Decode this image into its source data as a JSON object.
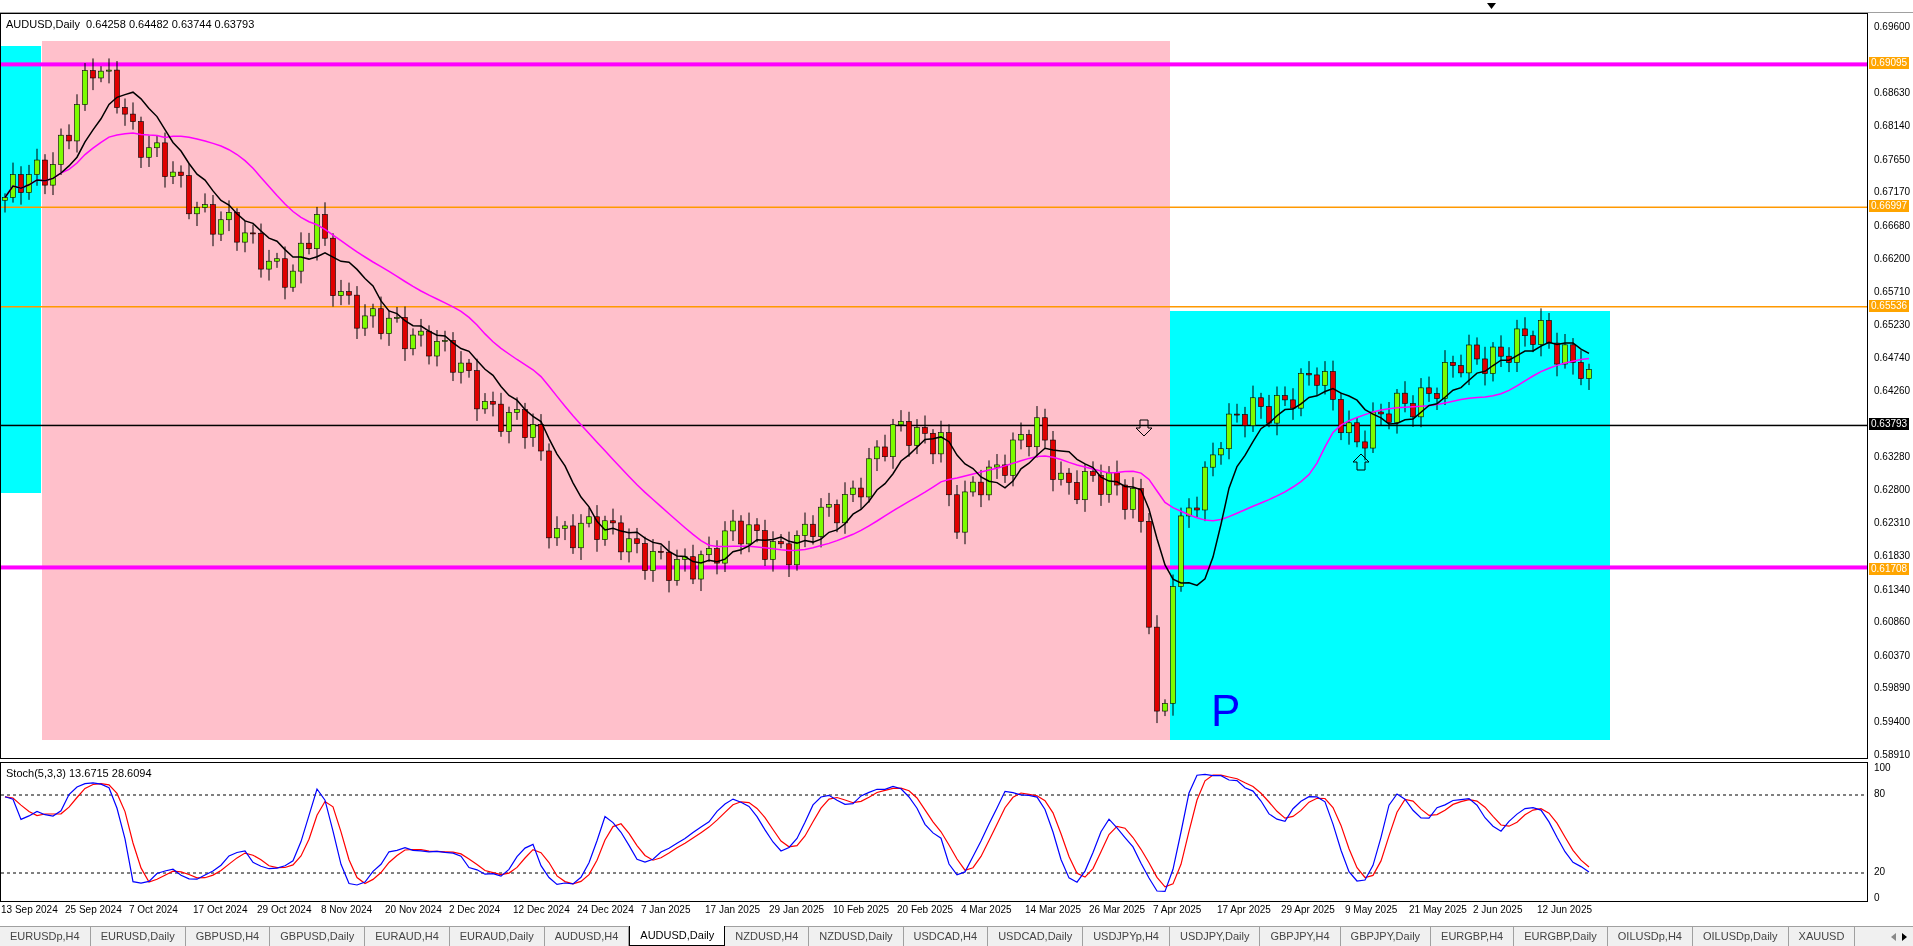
{
  "chart_header": {
    "symbol": "AUDUSD,Daily",
    "ohlc": "0.64258 0.64482 0.63744 0.63793"
  },
  "price_axis": [
    "0.69600",
    "0.68630",
    "0.68140",
    "0.67650",
    "0.67170",
    "0.66680",
    "0.66200",
    "0.65710",
    "0.65230",
    "0.64740",
    "0.64260",
    "0.63280",
    "0.62800",
    "0.62310",
    "0.61830",
    "0.61340",
    "0.60860",
    "0.60370",
    "0.59890",
    "0.59400",
    "0.58910"
  ],
  "levels": [
    {
      "label": "0.69095",
      "color": "#ff00ff",
      "kind": "thick"
    },
    {
      "label": "0.66997",
      "color": "#ff9900",
      "kind": "thin"
    },
    {
      "label": "0.65536",
      "color": "#ff9900",
      "kind": "thin"
    },
    {
      "label": "0.63793",
      "color": "#000000",
      "kind": "current"
    },
    {
      "label": "0.61708",
      "color": "#ff00ff",
      "kind": "thick"
    }
  ],
  "zone_letter": "P",
  "stoch": {
    "header": "Stoch(5,3,3) 13.6715 28.6094",
    "axis": [
      "100",
      "80",
      "20",
      "0"
    ]
  },
  "dates": [
    "13 Sep 2024",
    "25 Sep 2024",
    "7 Oct 2024",
    "17 Oct 2024",
    "29 Oct 2024",
    "8 Nov 2024",
    "20 Nov 2024",
    "2 Dec 2024",
    "12 Dec 2024",
    "24 Dec 2024",
    "7 Jan 2025",
    "17 Jan 2025",
    "29 Jan 2025",
    "10 Feb 2025",
    "20 Feb 2025",
    "4 Mar 2025",
    "14 Mar 2025",
    "26 Mar 2025",
    "7 Apr 2025",
    "17 Apr 2025",
    "29 Apr 2025",
    "9 May 2025",
    "21 May 2025",
    "2 Jun 2025",
    "12 Jun 2025"
  ],
  "tabs": [
    {
      "label": "EURUSDp,H4",
      "selected": false
    },
    {
      "label": "EURUSD,Daily",
      "selected": false
    },
    {
      "label": "GBPUSD,H4",
      "selected": false
    },
    {
      "label": "GBPUSD,Daily",
      "selected": false
    },
    {
      "label": "EURAUD,H4",
      "selected": false
    },
    {
      "label": "EURAUD,Daily",
      "selected": false
    },
    {
      "label": "AUDUSD,H4",
      "selected": false
    },
    {
      "label": "AUDUSD,Daily",
      "selected": true
    },
    {
      "label": "NZDUSD,H4",
      "selected": false
    },
    {
      "label": "NZDUSD,Daily",
      "selected": false
    },
    {
      "label": "USDCAD,H4",
      "selected": false
    },
    {
      "label": "USDCAD,Daily",
      "selected": false
    },
    {
      "label": "USDJPYp,H4",
      "selected": false
    },
    {
      "label": "USDJPY,Daily",
      "selected": false
    },
    {
      "label": "GBPJPY,H4",
      "selected": false
    },
    {
      "label": "GBPJPY,Daily",
      "selected": false
    },
    {
      "label": "EURGBP,H4",
      "selected": false
    },
    {
      "label": "EURGBP,Daily",
      "selected": false
    },
    {
      "label": "OILUSDp,H4",
      "selected": false
    },
    {
      "label": "OILUSDp,Daily",
      "selected": false
    },
    {
      "label": "XAUUSD",
      "selected": false
    }
  ]
}
